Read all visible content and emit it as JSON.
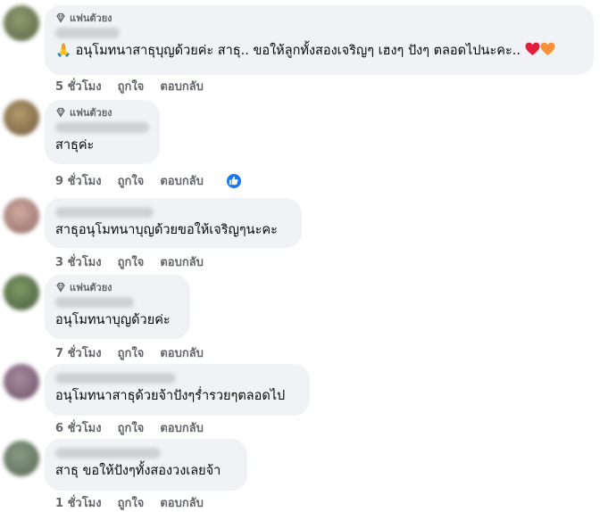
{
  "comments": [
    {
      "badge": "แฟนตัวยง",
      "prefix_emoji": "🙏",
      "text": "อนุโมทนาสาธุบุญด้วยค่ะ สาธุ.. ขอให้ลูกทั้งสองเจริญๆ เฮงๆ ปังๆ ตลอดไปนะคะ..",
      "time": "5 ชั่วโมง",
      "like": "ถูกใจ",
      "reply": "ตอบกลับ",
      "avatar_color": "#6f7d5a"
    },
    {
      "badge": "แฟนตัวยง",
      "text": "สาธุค่ะ",
      "time": "9 ชั่วโมง",
      "like": "ถูกใจ",
      "reply": "ตอบกลับ",
      "avatar_color": "#8a7552"
    },
    {
      "text": "สาธุอนุโมทนาบุญด้วยขอให้เจริญๆนะคะ",
      "time": "3 ชั่วโมง",
      "like": "ถูกใจ",
      "reply": "ตอบกลับ",
      "avatar_color": "#b58e86"
    },
    {
      "badge": "แฟนตัวยง",
      "text": "อนุโมทนาบุญด้วยค่ะ",
      "time": "7 ชั่วโมง",
      "like": "ถูกใจ",
      "reply": "ตอบกลับ",
      "avatar_color": "#5e7a4c"
    },
    {
      "text": "อนุโมทนาสาธุด้วยจ้าปังๆร่ำรวยๆตลอดไป",
      "time": "6 ชั่วโมง",
      "like": "ถูกใจ",
      "reply": "ตอบกลับ",
      "avatar_color": "#8a6f83"
    },
    {
      "text": "สาธุ ขอให้ปังๆทั้งสองวงเลยจ้า",
      "time": "1 ชั่วโมง",
      "like": "ถูกใจ",
      "reply": "ตอบกลับ",
      "avatar_color": "#6b7f6a"
    }
  ],
  "colors": {
    "bubble": "#f0f2f5",
    "action_text": "#65676b",
    "like_badge": "#1877f2",
    "heart_red": "#e41e3f",
    "heart_orange": "#f7923b"
  },
  "icons": [
    "diamond-icon",
    "pray-emoji",
    "red-heart-emoji",
    "orange-heart-emoji",
    "like-reaction-icon"
  ]
}
